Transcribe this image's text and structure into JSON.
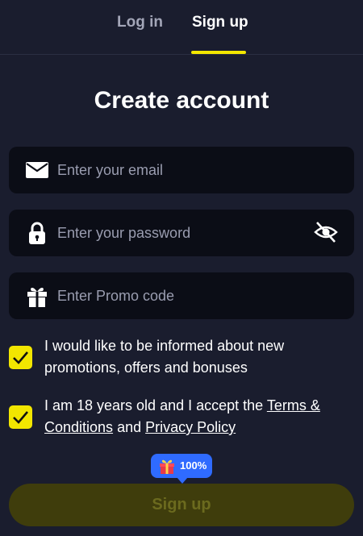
{
  "tabs": {
    "login": "Log in",
    "signup": "Sign up",
    "active": "signup"
  },
  "title": "Create account",
  "fields": {
    "email": {
      "placeholder": "Enter your email",
      "icon": "envelope-icon"
    },
    "password": {
      "placeholder": "Enter your password",
      "icon": "lock-icon",
      "toggle_icon": "eye-slash-icon"
    },
    "promo": {
      "placeholder": "Enter Promo code",
      "icon": "gift-icon"
    }
  },
  "checkboxes": {
    "promotions": {
      "checked": true,
      "text": "I would like to be informed about new promotions, offers and bonuses"
    },
    "terms": {
      "checked": true,
      "text_before": "I am 18 years old and I accept the ",
      "terms_link": "Terms & Conditions",
      "middle": " and ",
      "privacy_link": "Privacy Policy"
    }
  },
  "badge": {
    "text": "100%",
    "icon": "gift-box-icon"
  },
  "submit_label": "Sign up",
  "colors": {
    "background": "#1a1d2e",
    "accent": "#f2e600",
    "field": "#0b0d16",
    "badge": "#2f6bff"
  }
}
